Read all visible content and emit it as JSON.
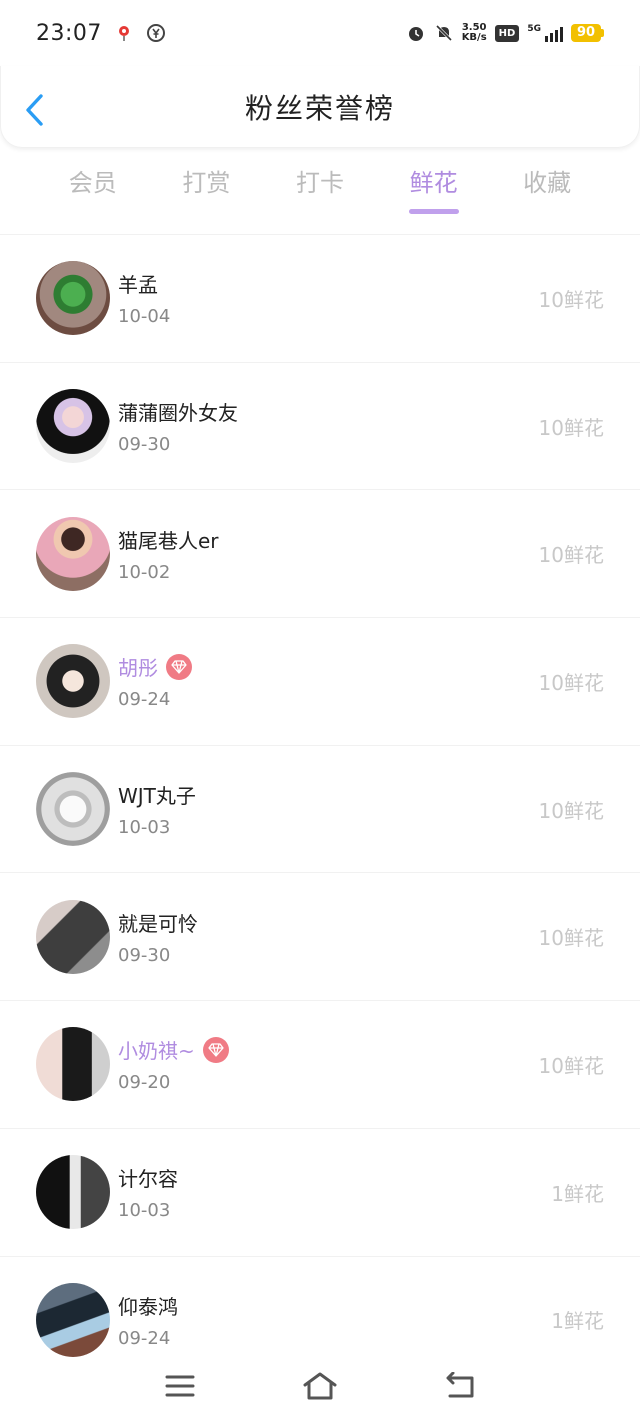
{
  "status_bar": {
    "time": "23:07",
    "net_speed_value": "3.50",
    "net_speed_unit": "KB/s",
    "hd_label": "HD",
    "signal_label": "5G",
    "battery": "90",
    "icons": [
      "map-pin-icon",
      "rmb-icon",
      "alarm-icon",
      "mute-icon"
    ]
  },
  "header": {
    "title": "粉丝荣誉榜",
    "back_icon": "chevron-left-icon",
    "accent_color": "#2a9df4"
  },
  "tabs": [
    {
      "label": "会员",
      "active": false
    },
    {
      "label": "打赏",
      "active": false
    },
    {
      "label": "打卡",
      "active": false
    },
    {
      "label": "鲜花",
      "active": true
    },
    {
      "label": "收藏",
      "active": false
    }
  ],
  "accent": "#b08ce0",
  "fans": [
    {
      "name": "羊孟",
      "date": "10-04",
      "amount": "10鲜花",
      "vip": false,
      "avatar": "green-clover-photo"
    },
    {
      "name": "蒲蒲圈外女友",
      "date": "09-30",
      "amount": "10鲜花",
      "vip": false,
      "avatar": "pink-hair-boy-photo"
    },
    {
      "name": "猫尾巷人er",
      "date": "10-02",
      "amount": "10鲜花",
      "vip": false,
      "avatar": "boy-pink-shirt-photo"
    },
    {
      "name": "胡彤",
      "date": "09-24",
      "amount": "10鲜花",
      "vip": true,
      "avatar": "girl-photo"
    },
    {
      "name": "WJT丸子",
      "date": "10-03",
      "amount": "10鲜花",
      "vip": false,
      "avatar": "anime-sketch-photo"
    },
    {
      "name": "就是可怜",
      "date": "09-30",
      "amount": "10鲜花",
      "vip": false,
      "avatar": "dark-hair-girl-photo"
    },
    {
      "name": "小奶祺~",
      "date": "09-20",
      "amount": "10鲜花",
      "vip": true,
      "avatar": "couple-photo"
    },
    {
      "name": "计尔容",
      "date": "10-03",
      "amount": "1鲜花",
      "vip": false,
      "avatar": "bw-girl-photo"
    },
    {
      "name": "仰泰鸿",
      "date": "09-24",
      "amount": "1鲜花",
      "vip": false,
      "avatar": "hands-photo"
    }
  ],
  "nav": {
    "icons": [
      "menu-icon",
      "home-icon",
      "back-icon"
    ]
  }
}
